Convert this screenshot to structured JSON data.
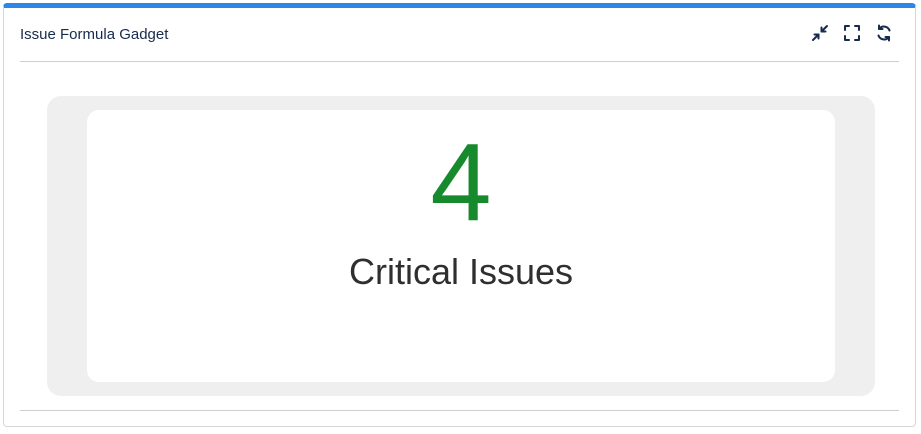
{
  "gadget": {
    "title": "Issue Formula Gadget",
    "accent_color": "#2f86e8",
    "actions": [
      {
        "name": "minimize",
        "icon": "collapse-arrows-icon"
      },
      {
        "name": "maximize",
        "icon": "fullscreen-icon"
      },
      {
        "name": "refresh",
        "icon": "refresh-icon"
      }
    ]
  },
  "metric": {
    "value": "4",
    "label": "Critical Issues",
    "value_color": "#178a2e"
  }
}
